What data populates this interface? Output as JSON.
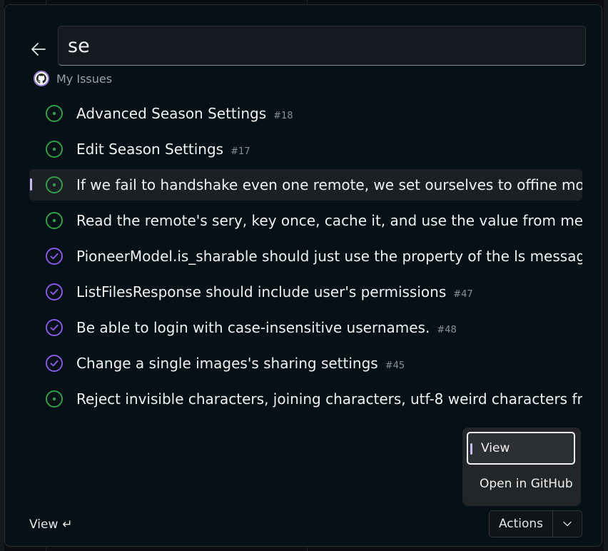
{
  "search": {
    "value": "se"
  },
  "section": {
    "label": "My Issues"
  },
  "issues": [
    {
      "title": "Advanced Season Settings",
      "number": "#18",
      "state": "open"
    },
    {
      "title": "Edit Season Settings",
      "number": "#17",
      "state": "open"
    },
    {
      "title": "If we fail to handshake even one remote, we set ourselves to offine mo",
      "number": "",
      "state": "open",
      "selected": true
    },
    {
      "title": "Read the remote's sery, key once, cache it, and use the value from men",
      "number": "",
      "state": "open"
    },
    {
      "title": "PioneerModel.is_sharable should just use the property of the ls messag",
      "number": "",
      "state": "closed"
    },
    {
      "title": "ListFilesResponse should include user's permissions",
      "number": "#47",
      "state": "closed"
    },
    {
      "title": "Be able to login with case-insensitive usernames.",
      "number": "#48",
      "state": "closed"
    },
    {
      "title": "Change a single images's sharing settings",
      "number": "#45",
      "state": "closed"
    },
    {
      "title": "Reject invisible characters, joining characters, utf-8 weird characters fro",
      "number": "",
      "state": "open"
    }
  ],
  "context_menu": {
    "items": [
      "View",
      "Open in GitHub"
    ]
  },
  "footer": {
    "primary_action": "View",
    "enter_glyph": "↵",
    "actions_label": "Actions"
  },
  "colors": {
    "open": "#2ea043",
    "closed": "#8957e5",
    "accent": "#c9b8f2"
  }
}
